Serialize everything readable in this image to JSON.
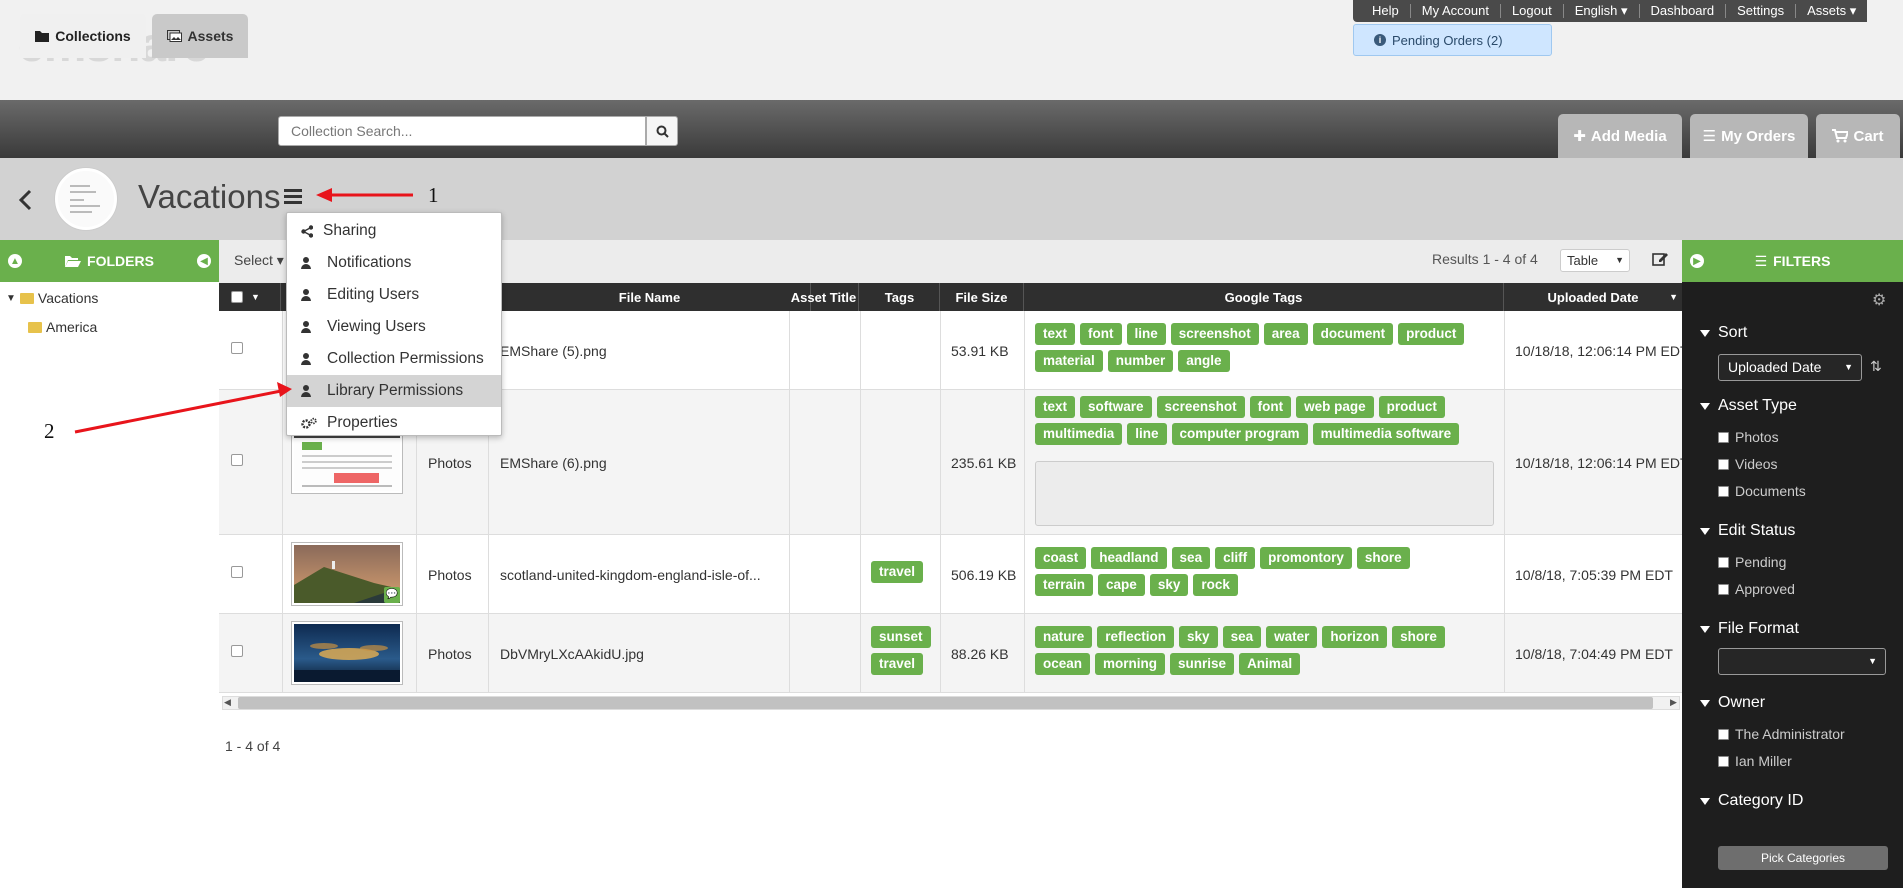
{
  "brand": {
    "logo_text": "emshare"
  },
  "top_menu": {
    "items": [
      "Help",
      "My Account",
      "Logout",
      "English ▾",
      "Dashboard",
      "Settings",
      "Assets ▾"
    ]
  },
  "pending_orders": "Pending Orders (2)",
  "nav": {
    "collections_tab": "Collections",
    "assets_tab": "Assets",
    "search_placeholder": "Collection Search...",
    "add_media": "Add Media",
    "my_orders": "My Orders",
    "cart": "Cart"
  },
  "collection": {
    "title": "Vacations"
  },
  "annotations": {
    "one": "1",
    "two": "2"
  },
  "folders": {
    "header": "FOLDERS",
    "tree": [
      "Vacations",
      "America"
    ]
  },
  "toolbar": {
    "select_label": "Select ▾",
    "results": "Results 1 - 4 of 4",
    "view": "Table"
  },
  "menu": {
    "items": [
      "Sharing",
      "Notifications",
      "Editing Users",
      "Viewing Users",
      "Collection Permissions",
      "Library Permissions",
      "Properties"
    ],
    "highlighted": "Library Permissions"
  },
  "table": {
    "headers": [
      "File Name",
      "Asset Title",
      "Tags",
      "File Size",
      "Google Tags",
      "Uploaded Date"
    ],
    "rows": [
      {
        "type": "",
        "file_name": "EMShare (5).png",
        "tags": [],
        "file_size": "53.91 KB",
        "google_tags": [
          "text",
          "font",
          "line",
          "screenshot",
          "area",
          "document",
          "product",
          "material",
          "number",
          "angle"
        ],
        "uploaded": "10/18/18, 12:06:14 PM EDT"
      },
      {
        "type": "Photos",
        "file_name": "EMShare (6).png",
        "tags": [],
        "file_size": "235.61 KB",
        "google_tags": [
          "text",
          "software",
          "screenshot",
          "font",
          "web page",
          "product",
          "multimedia",
          "line",
          "computer program",
          "multimedia software"
        ],
        "uploaded": "10/18/18, 12:06:14 PM EDT"
      },
      {
        "type": "Photos",
        "file_name": "scotland-united-kingdom-england-isle-of...",
        "tags": [
          "travel"
        ],
        "file_size": "506.19 KB",
        "google_tags": [
          "coast",
          "headland",
          "sea",
          "cliff",
          "promontory",
          "shore",
          "terrain",
          "cape",
          "sky",
          "rock"
        ],
        "uploaded": "10/8/18, 7:05:39 PM EDT"
      },
      {
        "type": "Photos",
        "file_name": "DbVMryLXcAAkidU.jpg",
        "tags": [
          "sunset",
          "travel"
        ],
        "file_size": "88.26 KB",
        "google_tags": [
          "nature",
          "reflection",
          "sky",
          "sea",
          "water",
          "horizon",
          "shore",
          "ocean",
          "morning",
          "sunrise",
          "Animal"
        ],
        "uploaded": "10/8/18, 7:04:49 PM EDT"
      }
    ],
    "footer": "1 - 4 of 4"
  },
  "filters": {
    "header": "FILTERS",
    "sort": {
      "label": "Sort",
      "value": "Uploaded Date"
    },
    "asset_type": {
      "label": "Asset Type",
      "options": [
        "Photos",
        "Videos",
        "Documents"
      ]
    },
    "edit_status": {
      "label": "Edit Status",
      "options": [
        "Pending",
        "Approved"
      ]
    },
    "file_format": {
      "label": "File Format",
      "value": ""
    },
    "owner": {
      "label": "Owner",
      "options": [
        "The Administrator",
        "Ian Miller"
      ]
    },
    "category": {
      "label": "Category ID",
      "button": "Pick Categories"
    }
  },
  "colors": {
    "accent_green": "#6ab04c",
    "annotation_red": "#e8141b",
    "dark_panel": "#1e1e1e"
  }
}
